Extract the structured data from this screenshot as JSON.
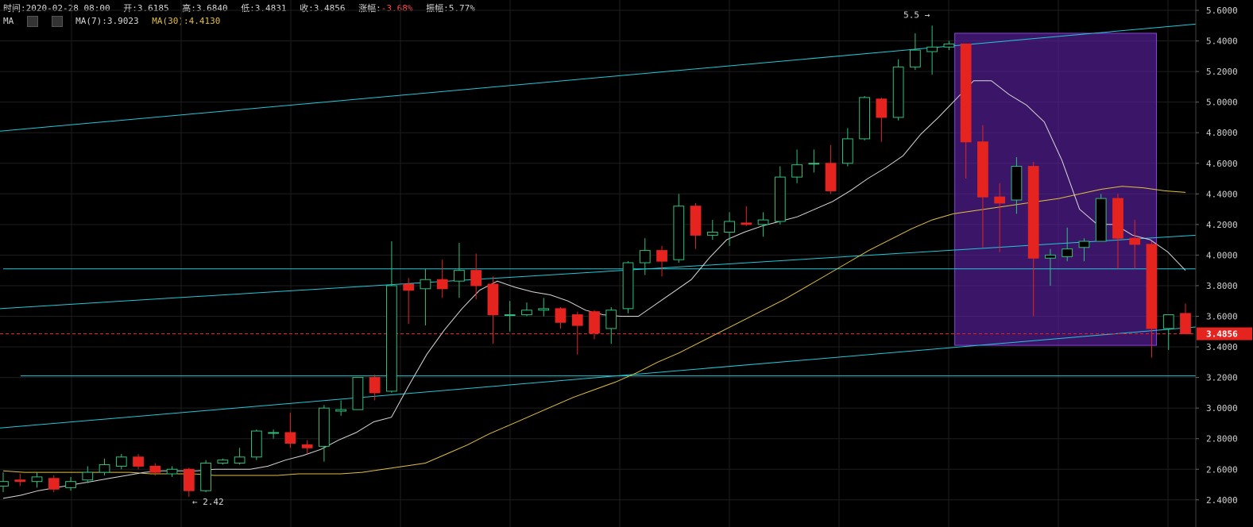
{
  "info_bar": {
    "time": "时间:2020-02-28 08:00",
    "open": "开:3.6185",
    "high": "高:3.6840",
    "low": "低:3.4831",
    "close": "收:3.4856",
    "change_label": "涨幅:",
    "change_value": "-3.68%",
    "amplitude": "振幅:5.77%"
  },
  "ma_bar": {
    "label": "MA",
    "ma7": "MA(7):3.9023",
    "ma30": "MA(30):4.4130",
    "settings_icon": "gear-icon",
    "close_icon": "close-icon"
  },
  "colors": {
    "up": "#2ec27e",
    "down": "#e52420",
    "ma7": "#d8d8d8",
    "ma30": "#e0c040",
    "trendline": "#22c8d8",
    "box_fill": "#5a22a0",
    "box_stroke": "#8a40e0",
    "price_line": "#e52420"
  },
  "chart_data": {
    "type": "candlestick",
    "ylim": [
      2.36,
      5.62
    ],
    "y_ticks": [
      "5.6000",
      "5.4000",
      "5.2000",
      "5.0000",
      "4.8000",
      "4.6000",
      "4.4000",
      "4.2000",
      "4.0000",
      "3.8000",
      "3.6000",
      "3.4000",
      "3.2000",
      "3.0000",
      "2.8000",
      "2.6000",
      "2.4000"
    ],
    "current_price": "3.4856",
    "annotations": {
      "high_label": "5.5 →",
      "low_label": "← 2.42"
    },
    "candles": [
      [
        2.49,
        2.52,
        2.45,
        2.58
      ],
      [
        2.53,
        2.52,
        2.49,
        2.57
      ],
      [
        2.52,
        2.55,
        2.48,
        2.58
      ],
      [
        2.54,
        2.47,
        2.45,
        2.56
      ],
      [
        2.48,
        2.52,
        2.46,
        2.55
      ],
      [
        2.53,
        2.58,
        2.51,
        2.62
      ],
      [
        2.58,
        2.63,
        2.56,
        2.67
      ],
      [
        2.62,
        2.68,
        2.6,
        2.7
      ],
      [
        2.68,
        2.62,
        2.6,
        2.7
      ],
      [
        2.62,
        2.58,
        2.56,
        2.64
      ],
      [
        2.57,
        2.6,
        2.55,
        2.62
      ],
      [
        2.6,
        2.46,
        2.42,
        2.61
      ],
      [
        2.46,
        2.64,
        2.45,
        2.66
      ],
      [
        2.64,
        2.66,
        2.63,
        2.67
      ],
      [
        2.64,
        2.68,
        2.63,
        2.74
      ],
      [
        2.68,
        2.85,
        2.66,
        2.86
      ],
      [
        2.84,
        2.84,
        2.8,
        2.86
      ],
      [
        2.84,
        2.77,
        2.74,
        2.97
      ],
      [
        2.76,
        2.74,
        2.7,
        2.79
      ],
      [
        2.75,
        3.0,
        2.65,
        3.02
      ],
      [
        2.98,
        2.99,
        2.95,
        3.05
      ],
      [
        2.99,
        3.2,
        2.99,
        3.2
      ],
      [
        3.2,
        3.1,
        3.05,
        3.22
      ],
      [
        3.11,
        3.8,
        3.1,
        4.09
      ],
      [
        3.81,
        3.77,
        3.55,
        3.85
      ],
      [
        3.78,
        3.84,
        3.54,
        3.91
      ],
      [
        3.84,
        3.78,
        3.72,
        3.97
      ],
      [
        3.83,
        3.9,
        3.72,
        4.08
      ],
      [
        3.9,
        3.8,
        3.71,
        4.01
      ],
      [
        3.81,
        3.61,
        3.42,
        3.86
      ],
      [
        3.61,
        3.61,
        3.5,
        3.7
      ],
      [
        3.61,
        3.64,
        3.6,
        3.69
      ],
      [
        3.64,
        3.65,
        3.6,
        3.72
      ],
      [
        3.65,
        3.56,
        3.52,
        3.66
      ],
      [
        3.61,
        3.54,
        3.35,
        3.63
      ],
      [
        3.63,
        3.49,
        3.45,
        3.64
      ],
      [
        3.52,
        3.64,
        3.42,
        3.66
      ],
      [
        3.65,
        3.95,
        3.62,
        3.96
      ],
      [
        3.95,
        4.03,
        3.87,
        4.11
      ],
      [
        4.03,
        3.96,
        3.86,
        4.06
      ],
      [
        3.97,
        4.32,
        3.95,
        4.4
      ],
      [
        4.32,
        4.13,
        4.04,
        4.34
      ],
      [
        4.13,
        4.15,
        4.1,
        4.23
      ],
      [
        4.15,
        4.22,
        4.06,
        4.28
      ],
      [
        4.21,
        4.2,
        4.19,
        4.32
      ],
      [
        4.2,
        4.23,
        4.12,
        4.28
      ],
      [
        4.22,
        4.51,
        4.2,
        4.58
      ],
      [
        4.51,
        4.59,
        4.47,
        4.69
      ],
      [
        4.6,
        4.6,
        4.54,
        4.69
      ],
      [
        4.6,
        4.42,
        4.4,
        4.72
      ],
      [
        4.6,
        4.76,
        4.58,
        4.83
      ],
      [
        4.76,
        5.03,
        4.75,
        5.04
      ],
      [
        5.02,
        4.9,
        4.74,
        5.03
      ],
      [
        4.9,
        5.23,
        4.88,
        5.28
      ],
      [
        5.23,
        5.34,
        5.21,
        5.45
      ],
      [
        5.33,
        5.36,
        5.18,
        5.5
      ],
      [
        5.36,
        5.38,
        5.34,
        5.4
      ],
      [
        5.38,
        4.74,
        4.5,
        5.37
      ],
      [
        4.74,
        4.38,
        4.05,
        4.85
      ],
      [
        4.38,
        4.34,
        4.02,
        4.47
      ],
      [
        4.36,
        4.58,
        4.27,
        4.64
      ],
      [
        4.58,
        3.98,
        3.6,
        4.61
      ],
      [
        3.98,
        4.0,
        3.8,
        4.04
      ],
      [
        3.99,
        4.04,
        3.96,
        4.18
      ],
      [
        4.05,
        4.09,
        3.96,
        4.11
      ],
      [
        4.09,
        4.37,
        4.09,
        4.4
      ],
      [
        4.37,
        4.11,
        3.91,
        4.4
      ],
      [
        4.11,
        4.07,
        3.91,
        4.23
      ],
      [
        4.07,
        3.52,
        3.33,
        4.09
      ],
      [
        3.52,
        3.61,
        3.38,
        3.61
      ],
      [
        3.6185,
        3.4856,
        3.4831,
        3.684
      ]
    ],
    "ma7": [
      2.41,
      2.43,
      2.46,
      2.48,
      2.5,
      2.52,
      2.54,
      2.56,
      2.58,
      2.59,
      2.59,
      2.59,
      2.6,
      2.6,
      2.6,
      2.62,
      2.66,
      2.69,
      2.73,
      2.79,
      2.84,
      2.91,
      2.94,
      3.15,
      3.35,
      3.51,
      3.65,
      3.77,
      3.83,
      3.79,
      3.76,
      3.74,
      3.7,
      3.64,
      3.61,
      3.6,
      3.6,
      3.68,
      3.76,
      3.84,
      3.98,
      4.1,
      4.15,
      4.19,
      4.22,
      4.25,
      4.3,
      4.35,
      4.42,
      4.5,
      4.57,
      4.65,
      4.79,
      4.9,
      5.02,
      5.14,
      5.14,
      5.05,
      4.98,
      4.87,
      4.62,
      4.3,
      4.2,
      4.2,
      4.13,
      4.1,
      4.02,
      3.9
    ],
    "ma30": [
      2.59,
      2.58,
      2.58,
      2.58,
      2.58,
      2.58,
      2.58,
      2.57,
      2.57,
      2.57,
      2.56,
      2.56,
      2.56,
      2.56,
      2.57,
      2.57,
      2.57,
      2.58,
      2.6,
      2.62,
      2.64,
      2.7,
      2.76,
      2.83,
      2.89,
      2.95,
      3.01,
      3.07,
      3.12,
      3.17,
      3.23,
      3.3,
      3.36,
      3.43,
      3.5,
      3.57,
      3.64,
      3.71,
      3.79,
      3.87,
      3.95,
      4.03,
      4.1,
      4.17,
      4.23,
      4.27,
      4.29,
      4.31,
      4.33,
      4.35,
      4.37,
      4.4,
      4.43,
      4.45,
      4.44,
      4.42,
      4.41
    ]
  }
}
